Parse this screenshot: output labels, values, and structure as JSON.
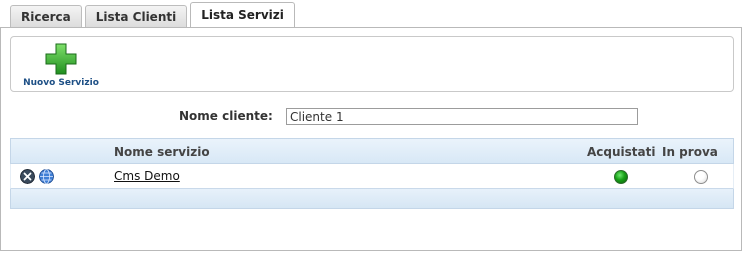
{
  "tabs": [
    {
      "label": "Ricerca",
      "active": false
    },
    {
      "label": "Lista Clienti",
      "active": false
    },
    {
      "label": "Lista Servizi",
      "active": true
    }
  ],
  "toolbar": {
    "new_service_label": "Nuovo Servizio",
    "new_service_icon": "green-plus-icon"
  },
  "client": {
    "label": "Nome cliente:",
    "value": "Cliente 1"
  },
  "table": {
    "headers": {
      "name": "Nome servizio",
      "purchased": "Acquistati",
      "trial": "In prova"
    },
    "rows": [
      {
        "name": "Cms Demo",
        "purchased": true,
        "trial": false,
        "icons": [
          "tools-icon",
          "globe-icon"
        ]
      }
    ]
  },
  "colors": {
    "link": "#1d4f85",
    "header_bg": "#d8e8f6",
    "status_green": "#17a017"
  }
}
